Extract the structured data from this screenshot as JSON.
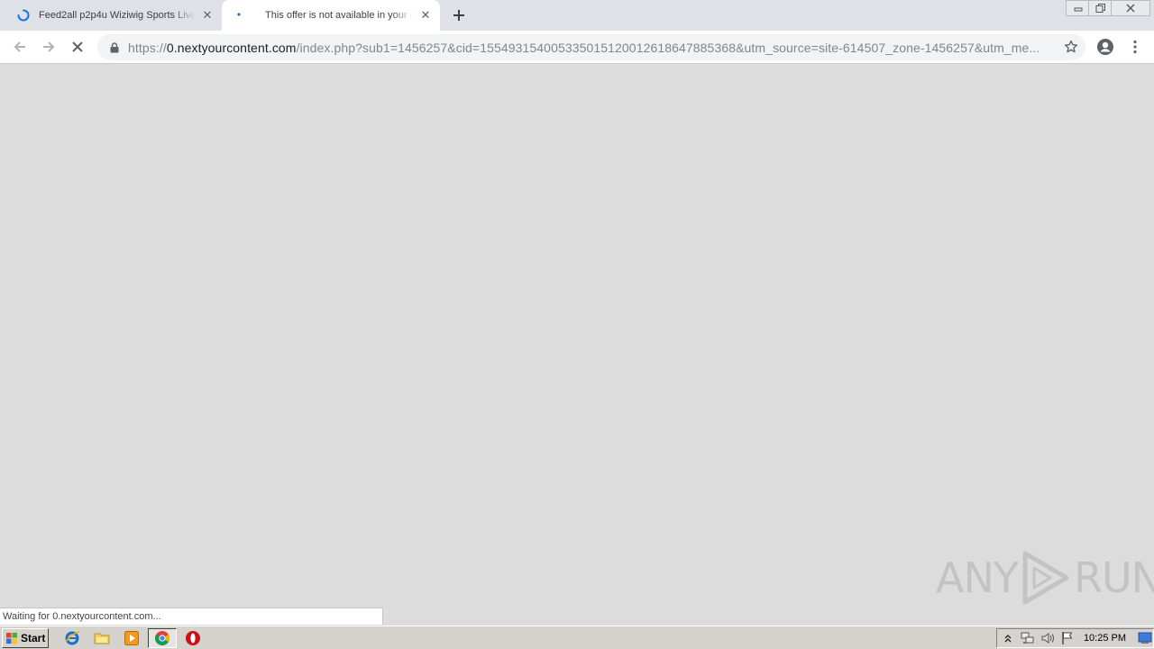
{
  "browser": {
    "tabs": [
      {
        "title": "Feed2all p2p4u Wiziwig Sports Live F",
        "loading": true,
        "active": false
      },
      {
        "title": "This offer is not available in your cou",
        "loading": true,
        "active": true
      }
    ],
    "newtab_icon": "plus-icon",
    "toolbar": {
      "url_scheme": "https://",
      "url_host": "0.nextyourcontent.com",
      "url_rest": "/index.php?sub1=1456257&cid=155493154005335015120012618647885368&utm_source=site-614507_zone-1456257&utm_me..."
    }
  },
  "status_text": "Waiting for 0.nextyourcontent.com...",
  "watermark": {
    "left": "ANY",
    "right": "RUN"
  },
  "taskbar": {
    "start_label": "Start",
    "pinned_icons": [
      "internet-explorer-icon",
      "explorer-folder-icon",
      "media-player-icon",
      "chrome-icon",
      "opera-icon"
    ],
    "clock": "10:25 PM"
  }
}
